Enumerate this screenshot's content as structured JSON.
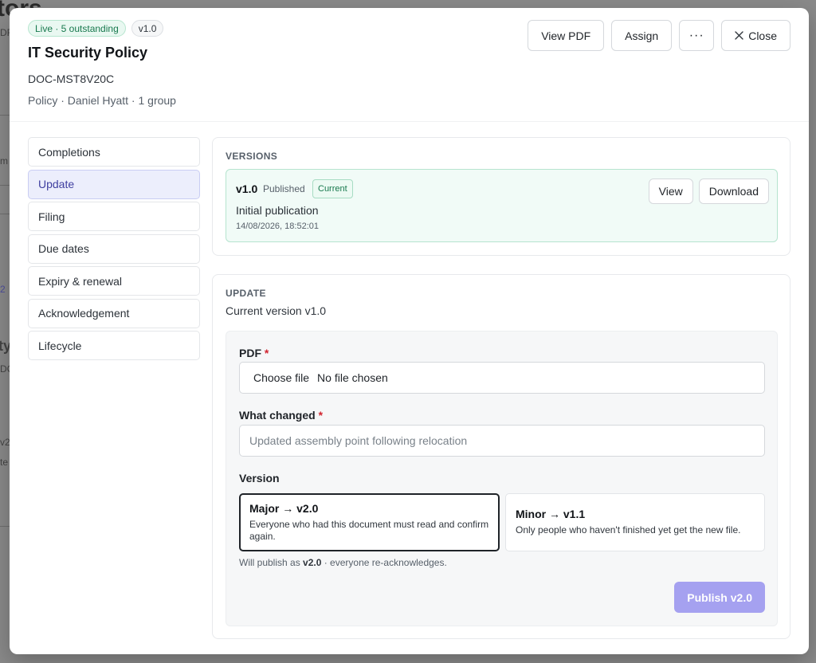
{
  "background": {
    "title_fragment": "tors",
    "fragments": [
      "DF",
      "m",
      "2",
      "ty",
      "DC",
      "v2",
      "te"
    ]
  },
  "header": {
    "badge_live": "Live · 5 outstanding",
    "badge_version": "v1.0",
    "title": "IT Security Policy",
    "doc_code": "DOC-MST8V20C",
    "meta": "Policy · Daniel Hyatt · 1 group",
    "view_pdf_label": "View PDF",
    "assign_label": "Assign",
    "more_label": "···",
    "close_label": "Close"
  },
  "sidebar": {
    "items": [
      {
        "label": "Completions",
        "active": false
      },
      {
        "label": "Update",
        "active": true
      },
      {
        "label": "Filing",
        "active": false
      },
      {
        "label": "Due dates",
        "active": false
      },
      {
        "label": "Expiry & renewal",
        "active": false
      },
      {
        "label": "Acknowledgement",
        "active": false
      },
      {
        "label": "Lifecycle",
        "active": false
      }
    ]
  },
  "versions": {
    "heading": "VERSIONS",
    "items": [
      {
        "name": "v1.0",
        "status": "Published",
        "current_badge": "Current",
        "note": "Initial publication",
        "date": "14/08/2026, 18:52:01",
        "view_label": "View",
        "download_label": "Download"
      }
    ]
  },
  "update": {
    "heading": "UPDATE",
    "subtitle": "Current version v1.0",
    "pdf_label": "PDF",
    "required_mark": "*",
    "file_button": "Choose file",
    "file_status": "No file chosen",
    "changed_label": "What changed",
    "changed_placeholder": "Updated assembly point following relocation",
    "changed_value": "",
    "version_label": "Version",
    "major_title": "Major → v2.0",
    "major_desc": "Everyone who had this document must read and confirm again.",
    "minor_title": "Minor → v1.1",
    "minor_desc": "Only people who haven't finished yet get the new file.",
    "selected": "major",
    "will_publish_prefix": "Will publish as ",
    "will_publish_version": "v2.0",
    "will_publish_suffix": " · everyone re-acknowledges.",
    "publish_label": "Publish v2.0"
  },
  "colors": {
    "accent": "#a5a1f0",
    "live_green": "#18794e",
    "active_nav_bg": "#eceefc",
    "required": "#d1242f"
  },
  "icons": {
    "close": "close-icon",
    "more": "more-icon"
  }
}
